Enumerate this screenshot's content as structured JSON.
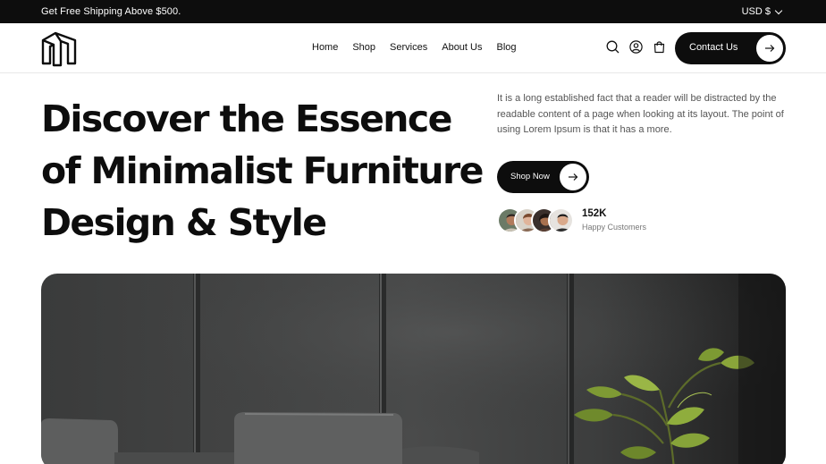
{
  "topbar": {
    "promo": "Get Free Shipping Above $500.",
    "currency": "USD $",
    "icon": "chevron-down-icon"
  },
  "header": {
    "logo_icon": "brand-logo-icon",
    "nav": [
      "Home",
      "Shop",
      "Services",
      "About Us",
      "Blog"
    ],
    "icons": [
      "search-icon",
      "user-icon",
      "cart-icon"
    ],
    "contact_label": "Contact Us",
    "contact_icon": "arrow-right-icon"
  },
  "hero": {
    "headline_lines": [
      "Discover the Essence",
      "of Minimalist Furniture",
      "Design & Style"
    ],
    "description": "It is a long established fact that a reader will be distracted by the readable content of a page when looking at its layout. The point of using Lorem Ipsum is that it has a more.",
    "cta_label": "Shop Now",
    "cta_icon": "arrow-right-icon",
    "customers_count": "152K",
    "customers_caption": "Happy Customers"
  },
  "colors": {
    "dark": "#0d0d0d",
    "background": "#ffffff",
    "muted_text": "#555555"
  }
}
